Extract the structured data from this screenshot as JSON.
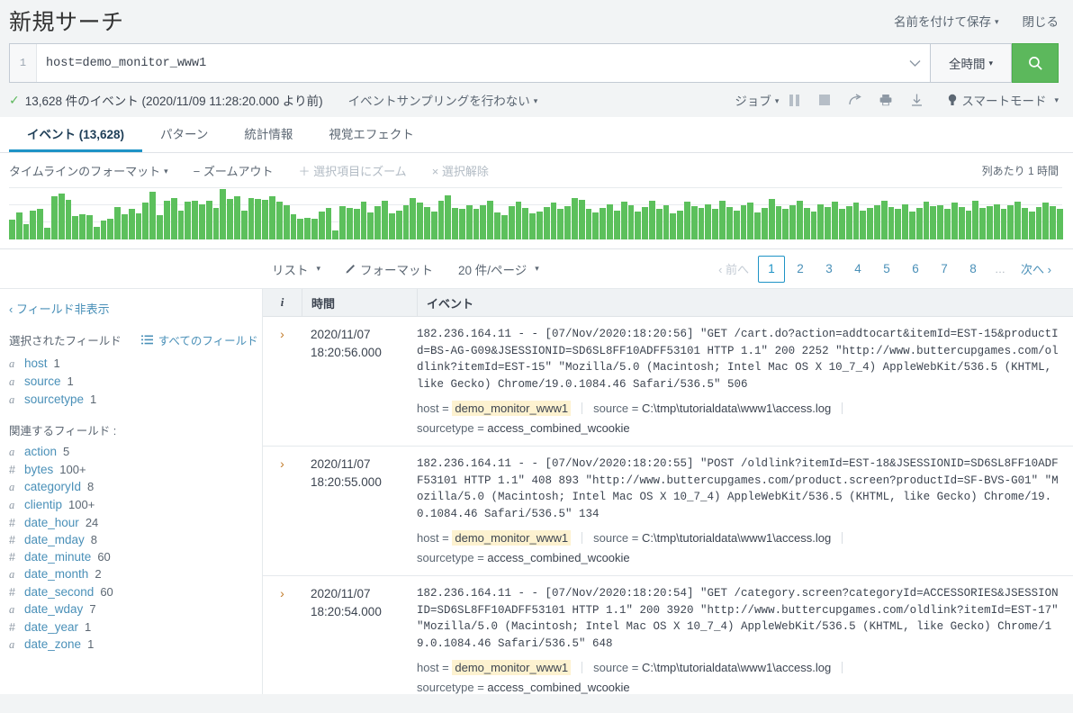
{
  "header": {
    "title": "新規サーチ",
    "save_as_label": "名前を付けて保存",
    "close_label": "閉じる"
  },
  "search": {
    "line_number": "1",
    "query": "host=demo_monitor_www1",
    "time_range_label": "全時間",
    "search_icon": "search-icon",
    "chevron_icon": "chevron-down-icon"
  },
  "result_bar": {
    "check_glyph": "✓",
    "events_summary": "13,628 件のイベント (2020/11/09 11:28:20.000 より前)",
    "sampling_label": "イベントサンプリングを行わない",
    "job_label": "ジョブ",
    "pause_icon": "pause-icon",
    "stop_icon": "stop-icon",
    "share_icon": "share-icon",
    "print_icon": "print-icon",
    "export_icon": "download-icon",
    "smart_mode_label": "スマートモード",
    "smart_mode_icon": "lightbulb-icon"
  },
  "tabs": [
    {
      "label": "イベント (13,628)",
      "active": true
    },
    {
      "label": "パターン",
      "active": false
    },
    {
      "label": "統計情報",
      "active": false
    },
    {
      "label": "視覚エフェクト",
      "active": false
    }
  ],
  "timeline": {
    "format_label": "タイムラインのフォーマット",
    "zoom_out_label": "− ズームアウト",
    "zoom_selection_label": "＋ 選択項目にズーム",
    "deselect_label": "× 選択解除",
    "per_column_label": "列あたり 1 時間",
    "bars": [
      38,
      52,
      30,
      56,
      58,
      22,
      82,
      88,
      76,
      44,
      48,
      46,
      24,
      36,
      40,
      62,
      48,
      58,
      50,
      70,
      92,
      46,
      74,
      80,
      56,
      72,
      74,
      68,
      74,
      60,
      96,
      78,
      82,
      56,
      80,
      78,
      76,
      82,
      72,
      66,
      48,
      40,
      42,
      40,
      54,
      60,
      18,
      64,
      60,
      58,
      72,
      52,
      64,
      74,
      50,
      56,
      66,
      80,
      70,
      62,
      54,
      74,
      84,
      60,
      58,
      66,
      58,
      66,
      74,
      52,
      46,
      64,
      72,
      60,
      50,
      54,
      62,
      70,
      58,
      64,
      80,
      76,
      58,
      52,
      60,
      68,
      56,
      72,
      66,
      54,
      62,
      74,
      58,
      66,
      50,
      56,
      72,
      64,
      60,
      68,
      58,
      74,
      62,
      56,
      66,
      70,
      52,
      60,
      78,
      64,
      58,
      66,
      74,
      60,
      54,
      68,
      62,
      72,
      58,
      64,
      70,
      56,
      60,
      66,
      74,
      62,
      58,
      68,
      54,
      60,
      72,
      64,
      66,
      58,
      70,
      62,
      56,
      74,
      60,
      64,
      68,
      58,
      66,
      72,
      60,
      54,
      62,
      70,
      64,
      58
    ]
  },
  "pager": {
    "list_label": "リスト",
    "format_label": "フォーマット",
    "format_icon": "pencil-icon",
    "per_page_label": "20 件/ページ",
    "prev_label": "‹ 前へ",
    "next_label": "次へ ›",
    "ellipsis": "…",
    "pages": [
      "1",
      "2",
      "3",
      "4",
      "5",
      "6",
      "7",
      "8"
    ],
    "current_page": "1"
  },
  "sidebar": {
    "hide_fields_label": "‹ フィールド非表示",
    "selected_fields_title": "選択されたフィールド",
    "all_fields_label": "すべてのフィールド",
    "all_fields_icon": "list-icon",
    "related_fields_title": "関連するフィールド :",
    "selected_fields": [
      {
        "type": "a",
        "name": "host",
        "count": "1"
      },
      {
        "type": "a",
        "name": "source",
        "count": "1"
      },
      {
        "type": "a",
        "name": "sourcetype",
        "count": "1"
      }
    ],
    "related_fields": [
      {
        "type": "a",
        "name": "action",
        "count": "5"
      },
      {
        "type": "#",
        "name": "bytes",
        "count": "100+"
      },
      {
        "type": "a",
        "name": "categoryId",
        "count": "8"
      },
      {
        "type": "a",
        "name": "clientip",
        "count": "100+"
      },
      {
        "type": "#",
        "name": "date_hour",
        "count": "24"
      },
      {
        "type": "#",
        "name": "date_mday",
        "count": "8"
      },
      {
        "type": "#",
        "name": "date_minute",
        "count": "60"
      },
      {
        "type": "a",
        "name": "date_month",
        "count": "2"
      },
      {
        "type": "#",
        "name": "date_second",
        "count": "60"
      },
      {
        "type": "a",
        "name": "date_wday",
        "count": "7"
      },
      {
        "type": "#",
        "name": "date_year",
        "count": "1"
      },
      {
        "type": "a",
        "name": "date_zone",
        "count": "1"
      }
    ]
  },
  "events_table": {
    "col_info": "i",
    "col_time": "時間",
    "col_event": "イベント",
    "expand_icon": "chevron-right-icon",
    "rows": [
      {
        "date": "2020/11/07",
        "time": "18:20:56.000",
        "raw": "182.236.164.11 - - [07/Nov/2020:18:20:56] \"GET /cart.do?action=addtocart&itemId=EST-15&productId=BS-AG-G09&JSESSIONID=SD6SL8FF10ADFF53101 HTTP 1.1\" 200 2252 \"http://www.buttercupgames.com/oldlink?itemId=EST-15\" \"Mozilla/5.0 (Macintosh; Intel Mac OS X 10_7_4) AppleWebKit/536.5 (KHTML, like Gecko) Chrome/19.0.1084.46 Safari/536.5\" 506",
        "host_key": "host",
        "host_value": "demo_monitor_www1",
        "source_key": "source",
        "source_value": "C:\\tmp\\tutorialdata\\www1\\access.log",
        "sourcetype_key": "sourcetype",
        "sourcetype_value": "access_combined_wcookie"
      },
      {
        "date": "2020/11/07",
        "time": "18:20:55.000",
        "raw": "182.236.164.11 - - [07/Nov/2020:18:20:55] \"POST /oldlink?itemId=EST-18&JSESSIONID=SD6SL8FF10ADFF53101 HTTP 1.1\" 408 893 \"http://www.buttercupgames.com/product.screen?productId=SF-BVS-G01\" \"Mozilla/5.0 (Macintosh; Intel Mac OS X 10_7_4) AppleWebKit/536.5 (KHTML, like Gecko) Chrome/19.0.1084.46 Safari/536.5\" 134",
        "host_key": "host",
        "host_value": "demo_monitor_www1",
        "source_key": "source",
        "source_value": "C:\\tmp\\tutorialdata\\www1\\access.log",
        "sourcetype_key": "sourcetype",
        "sourcetype_value": "access_combined_wcookie"
      },
      {
        "date": "2020/11/07",
        "time": "18:20:54.000",
        "raw": "182.236.164.11 - - [07/Nov/2020:18:20:54] \"GET /category.screen?categoryId=ACCESSORIES&JSESSIONID=SD6SL8FF10ADFF53101 HTTP 1.1\" 200 3920 \"http://www.buttercupgames.com/oldlink?itemId=EST-17\" \"Mozilla/5.0 (Macintosh; Intel Mac OS X 10_7_4) AppleWebKit/536.5 (KHTML, like Gecko) Chrome/19.0.1084.46 Safari/536.5\" 648",
        "host_key": "host",
        "host_value": "demo_monitor_www1",
        "source_key": "source",
        "source_value": "C:\\tmp\\tutorialdata\\www1\\access.log",
        "sourcetype_key": "sourcetype",
        "sourcetype_value": "access_combined_wcookie"
      }
    ]
  },
  "colors": {
    "accent_green": "#5cb85c",
    "bar_green": "#5cc05c",
    "link_blue": "#4a90b8",
    "tab_active": "#1e93c6",
    "highlight": "#fdf2d0"
  }
}
